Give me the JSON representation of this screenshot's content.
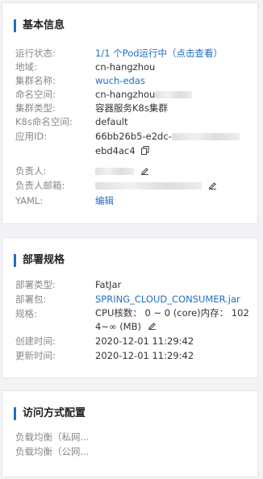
{
  "basic": {
    "title": "基本信息",
    "rows": [
      {
        "label": "运行状态:",
        "value": "1/1 个Pod运行中（点击查看）"
      },
      {
        "label": "地域:",
        "value": "cn-hangzhou"
      },
      {
        "label": "集群名称:",
        "value": "wuch-edas"
      },
      {
        "label": "命名空间:",
        "value": "cn-hangzhou"
      },
      {
        "label": "集群类型:",
        "value": "容器服务K8s集群"
      },
      {
        "label": "K8s命名空间:",
        "value": "default"
      },
      {
        "label": "应用ID:",
        "value_line1": "66bb26b5-e2dc-",
        "value_line2": "ebd4ac4"
      },
      {
        "label": "负责人:",
        "value": ""
      },
      {
        "label": "负责人邮箱:",
        "value": ""
      },
      {
        "label": "YAML:",
        "value": "编辑"
      }
    ]
  },
  "deploy": {
    "title": "部署规格",
    "rows": [
      {
        "label": "部署类型:",
        "value": "FatJar"
      },
      {
        "label": "部署包:",
        "value": "SPRING_CLOUD_CONSUMER.jar"
      },
      {
        "label": "规格:",
        "value_line1": "CPU核数： 0 ~ 0 (core)内存： 102",
        "value_line2": "4~∞ (MB)"
      },
      {
        "label": "创建时间:",
        "value": "2020-12-01 11:29:42"
      },
      {
        "label": "更新时间:",
        "value": "2020-12-01 11:29:42"
      }
    ]
  },
  "access": {
    "title": "访问方式配置",
    "rows": [
      {
        "label": "负载均衡（私网...",
        "value": ""
      },
      {
        "label": "负载均衡（公网...",
        "value": ""
      }
    ]
  },
  "icons": {
    "copy": "copy-icon",
    "edit": "edit-icon"
  },
  "colors": {
    "accent": "#1f6fc4",
    "label": "#888888",
    "text": "#333333"
  }
}
